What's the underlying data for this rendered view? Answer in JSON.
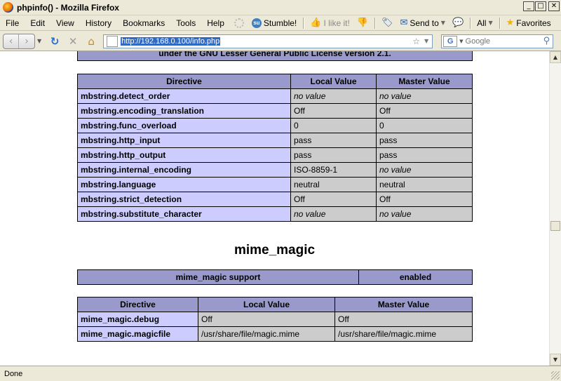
{
  "window": {
    "title": "phpinfo() - Mozilla Firefox"
  },
  "menubar": {
    "items": [
      "File",
      "Edit",
      "View",
      "History",
      "Bookmarks",
      "Tools",
      "Help"
    ],
    "stumble_label": "Stumble!",
    "ilike_label": "I like it!",
    "sendto_label": "Send to",
    "all_label": "All",
    "favorites_label": "Favorites"
  },
  "navbar": {
    "url": "http://192.168.0.100/info.php",
    "search_placeholder": "Google"
  },
  "page": {
    "license_text": "under the GNU Lesser General Public License version 2.1.",
    "mbstring_table": {
      "headers": [
        "Directive",
        "Local Value",
        "Master Value"
      ],
      "rows": [
        [
          "mbstring.detect_order",
          "no value",
          "no value"
        ],
        [
          "mbstring.encoding_translation",
          "Off",
          "Off"
        ],
        [
          "mbstring.func_overload",
          "0",
          "0"
        ],
        [
          "mbstring.http_input",
          "pass",
          "pass"
        ],
        [
          "mbstring.http_output",
          "pass",
          "pass"
        ],
        [
          "mbstring.internal_encoding",
          "ISO-8859-1",
          "no value"
        ],
        [
          "mbstring.language",
          "neutral",
          "neutral"
        ],
        [
          "mbstring.strict_detection",
          "Off",
          "Off"
        ],
        [
          "mbstring.substitute_character",
          "no value",
          "no value"
        ]
      ]
    },
    "mime_magic": {
      "title": "mime_magic",
      "support_label": "mime_magic support",
      "support_value": "enabled",
      "headers": [
        "Directive",
        "Local Value",
        "Master Value"
      ],
      "rows": [
        [
          "mime_magic.debug",
          "Off",
          "Off"
        ],
        [
          "mime_magic.magicfile",
          "/usr/share/file/magic.mime",
          "/usr/share/file/magic.mime"
        ]
      ]
    }
  },
  "status": {
    "text": "Done"
  }
}
